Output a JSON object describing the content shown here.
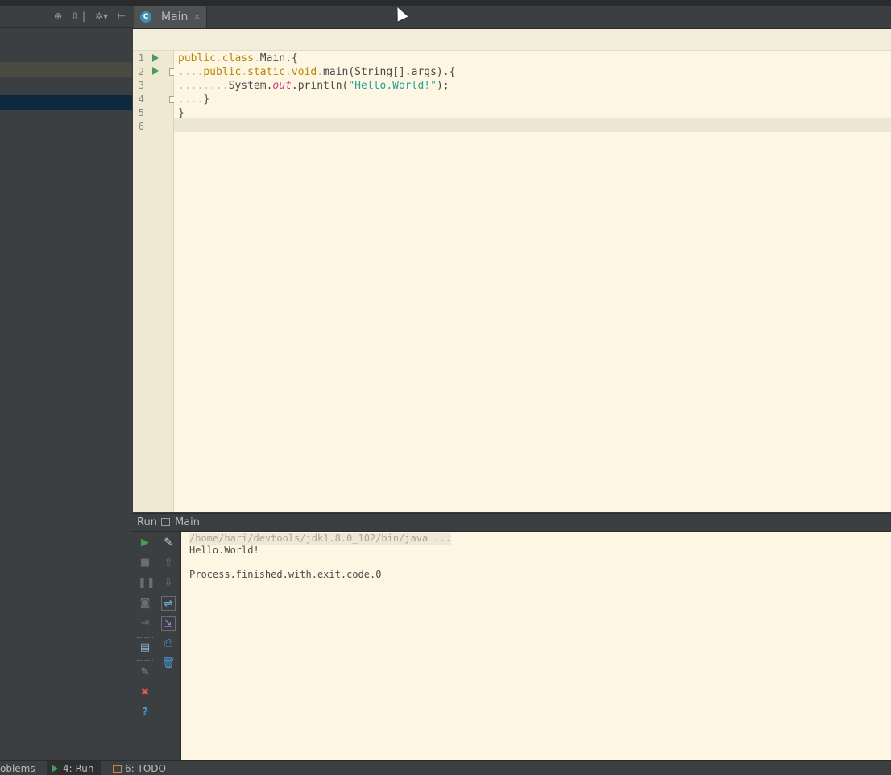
{
  "left_toolbar": {
    "icons": [
      "target-icon",
      "collapse-icon",
      "gear-icon",
      "hide-icon"
    ]
  },
  "editor": {
    "tab": {
      "label": "Main",
      "close_glyph": "×",
      "icon": "class-icon"
    },
    "line_numbers": [
      "1",
      "2",
      "3",
      "4",
      "5",
      "6"
    ],
    "code": {
      "line1": {
        "kw1": "public",
        "kw2": "class",
        "rest": "Main.{"
      },
      "line2": {
        "indent": "....",
        "kw1": "public",
        "kw2": "static",
        "kw3": "void",
        "rest": "main(String[].args).{"
      },
      "line3": {
        "indent": "........",
        "pre": "System.",
        "field": "out",
        "call": ".println(",
        "str": "\"Hello.World!\"",
        "end": ");"
      },
      "line4": {
        "indent": "....",
        "rest": "}"
      },
      "line5": {
        "rest": "}"
      }
    }
  },
  "run_panel": {
    "title": "Run",
    "config": "Main",
    "console": {
      "command": "/home/hari/devtools/jdk1.8.0_102/bin/java ...",
      "output": "Hello.World!",
      "exit": "Process.finished.with.exit.code.0"
    }
  },
  "bottom_bar": {
    "problems": "oblems",
    "run": "4: Run",
    "todo": "6: TODO"
  },
  "colors": {
    "editor_bg": "#fdf6e3",
    "keyword": "#b8860b",
    "string": "#2aa198",
    "field": "#d33682",
    "run_green": "#499c54"
  }
}
